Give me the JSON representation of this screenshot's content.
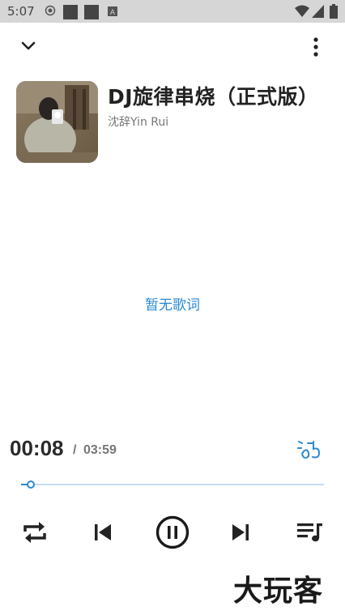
{
  "status_bar": {
    "time": "5:07",
    "icons": [
      "radio-icon",
      "square-icon",
      "square-icon",
      "a-icon",
      "wifi-icon",
      "signal-icon",
      "battery-icon"
    ]
  },
  "header": {
    "collapse_icon": "chevron-down-icon",
    "more_icon": "more-vertical-icon"
  },
  "song": {
    "title": "DJ旋律串烧（正式版）",
    "artist": "沈辞Yin Rui"
  },
  "lyrics": {
    "empty_text": "暂无歌词"
  },
  "player": {
    "current_time": "00:08",
    "separator": "/",
    "total_time": "03:59",
    "progress": 0.033,
    "accent_color": "#2b8ad1",
    "track_color": "#c5dcf2"
  },
  "controls": {
    "repeat": "repeat-icon",
    "previous": "skip-previous-icon",
    "play_pause": "pause-icon",
    "next": "skip-next-icon",
    "playlist": "playlist-icon"
  },
  "watermark": {
    "text": "大玩客"
  }
}
